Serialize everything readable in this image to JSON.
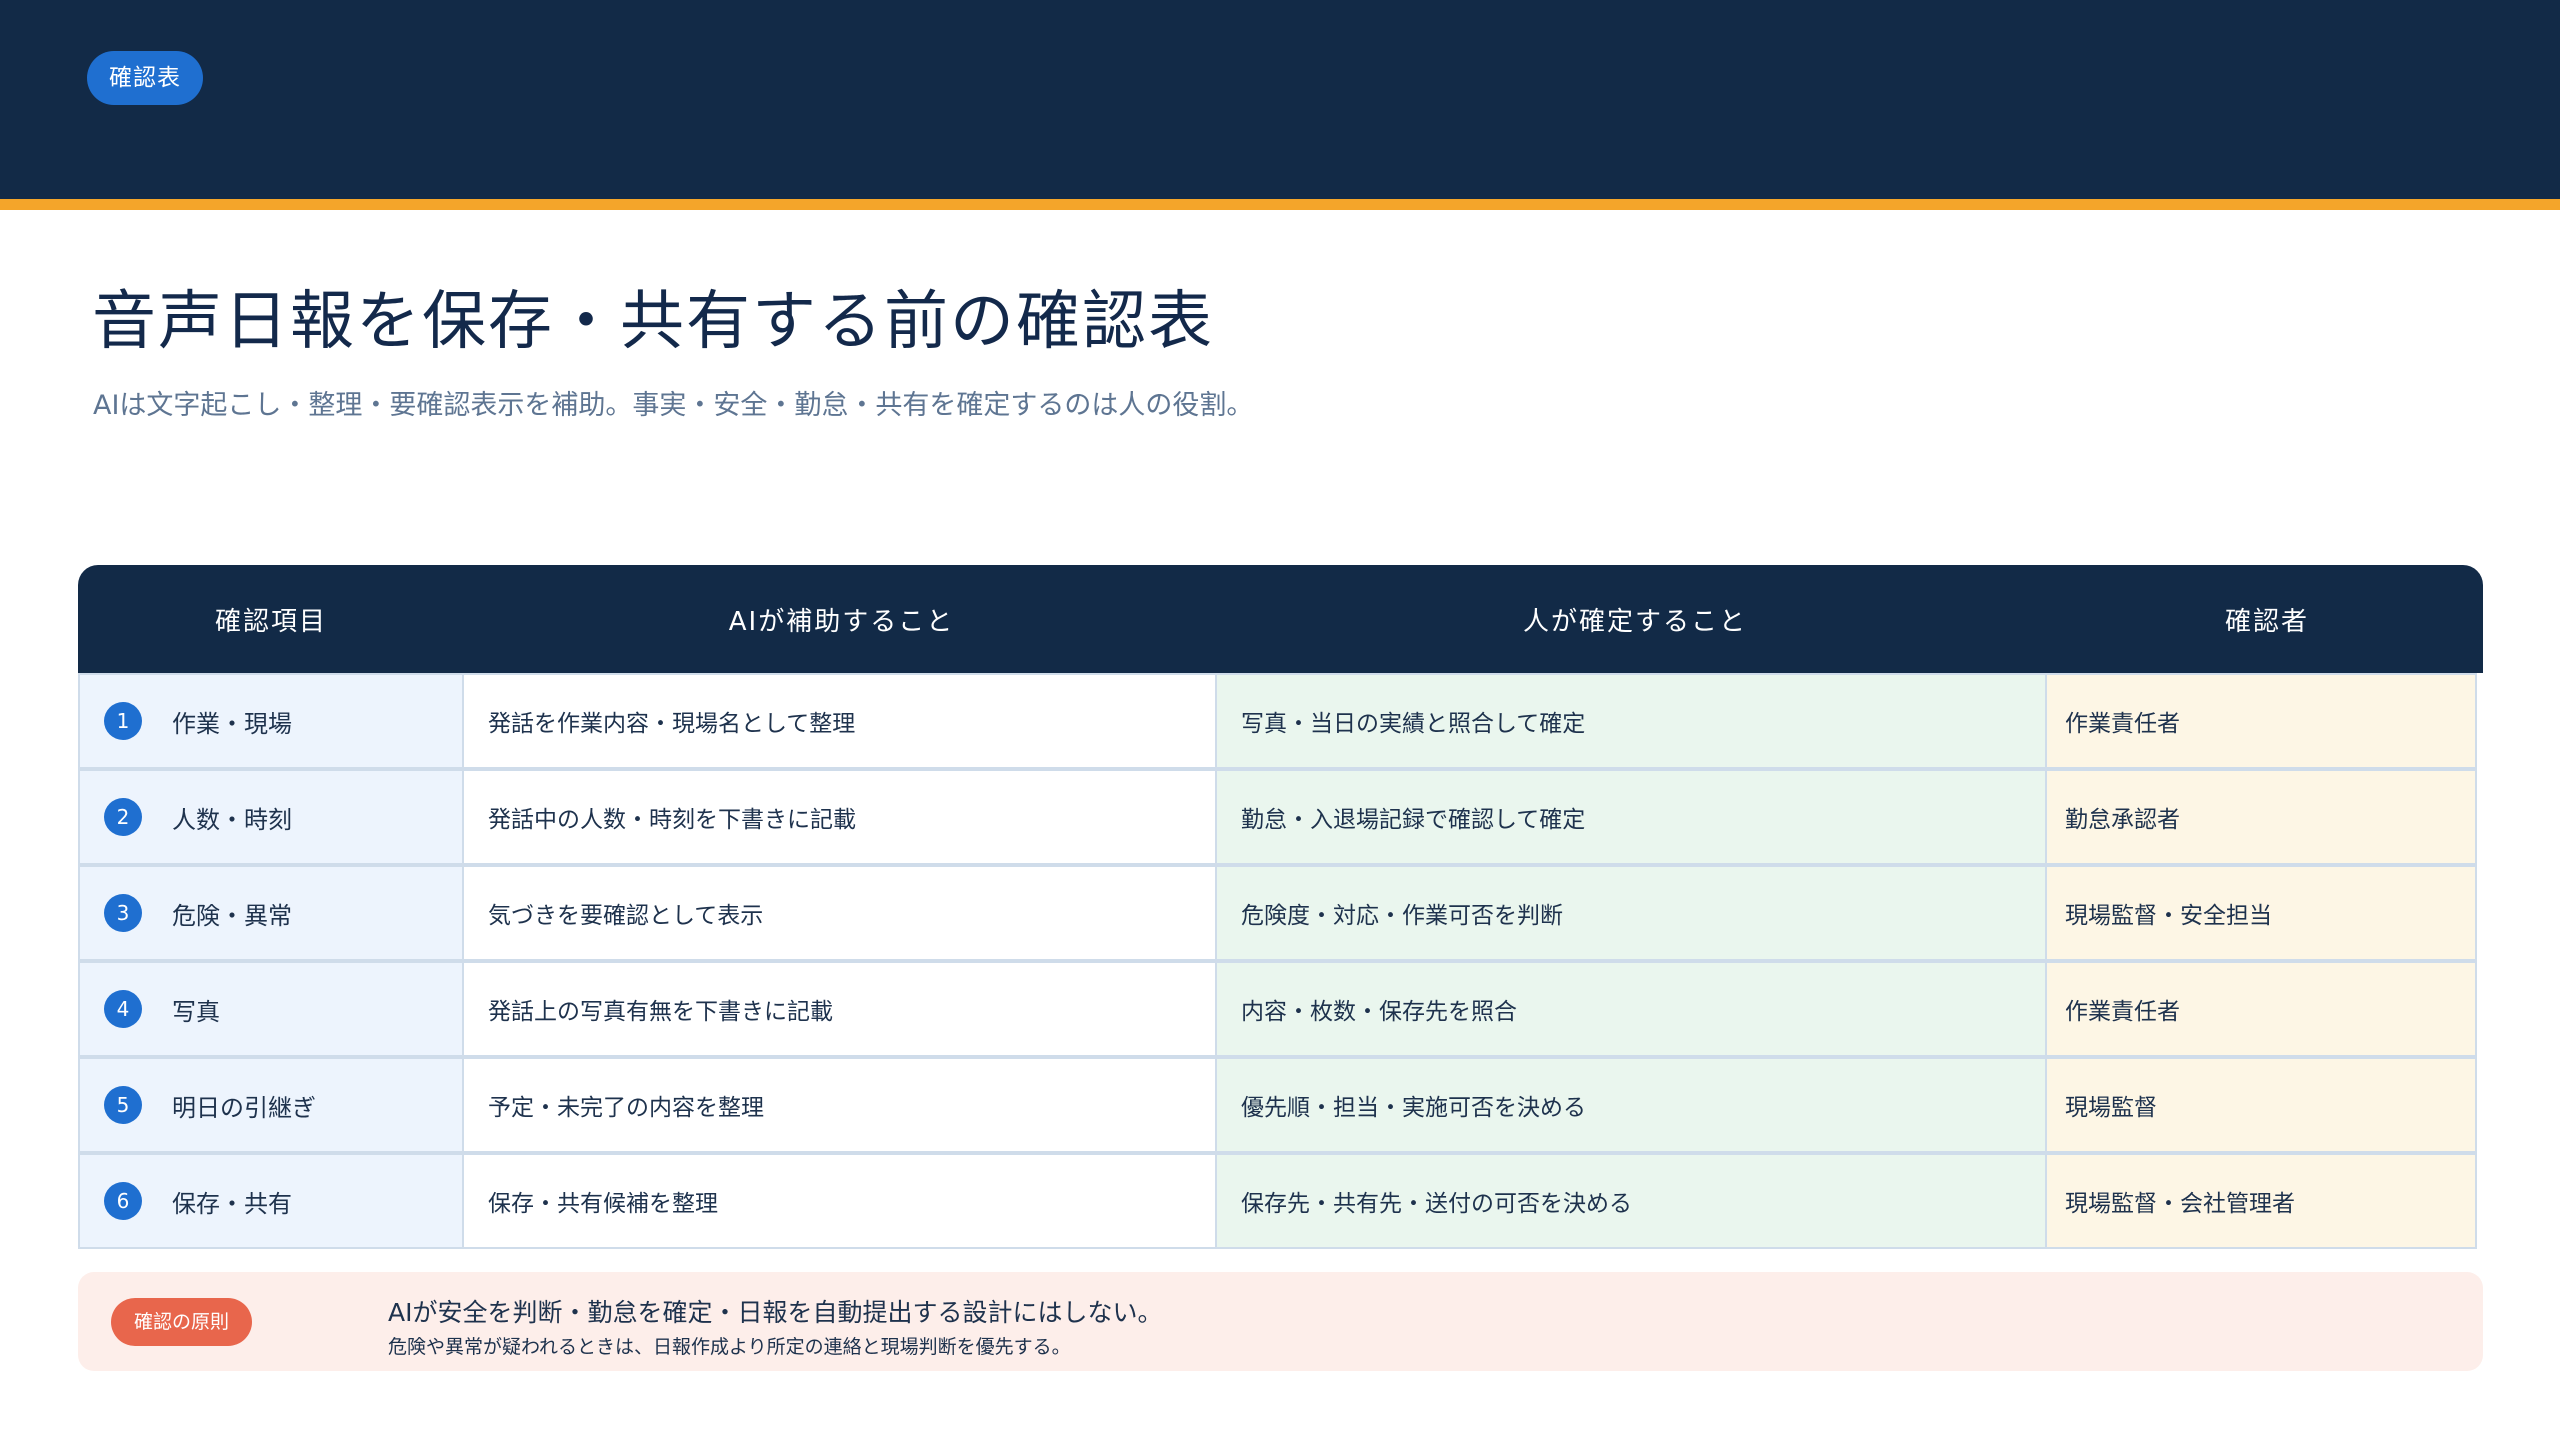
{
  "header": {
    "tag": "確認表",
    "bg_color": "#122a47",
    "stripe_color": "#f4a52a"
  },
  "page": {
    "title": "音声日報を保存・共有する前の確認表",
    "subtitle": "AIは文字起こし・整理・要確認表示を補助。事実・安全・勤怠・共有を確定するのは人の役割。"
  },
  "table": {
    "headers": [
      "確認項目",
      "AIが補助すること",
      "人が確定すること",
      "確認者"
    ],
    "rows": [
      {
        "num": "1",
        "item": "作業・現場",
        "ai": "発話を作業内容・現場名として整理",
        "human": "写真・当日の実績と照合して確定",
        "checker": "作業責任者"
      },
      {
        "num": "2",
        "item": "人数・時刻",
        "ai": "発話中の人数・時刻を下書きに記載",
        "human": "勤怠・入退場記録で確認して確定",
        "checker": "勤怠承認者"
      },
      {
        "num": "3",
        "item": "危険・異常",
        "ai": "気づきを要確認として表示",
        "human": "危険度・対応・作業可否を判断",
        "checker": "現場監督・安全担当"
      },
      {
        "num": "4",
        "item": "写真",
        "ai": "発話上の写真有無を下書きに記載",
        "human": "内容・枚数・保存先を照合",
        "checker": "作業責任者"
      },
      {
        "num": "5",
        "item": "明日の引継ぎ",
        "ai": "予定・未完了の内容を整理",
        "human": "優先順・担当・実施可否を決める",
        "checker": "現場監督"
      },
      {
        "num": "6",
        "item": "保存・共有",
        "ai": "保存・共有候補を整理",
        "human": "保存先・共有先・送付の可否を決める",
        "checker": "現場監督・会社管理者"
      }
    ]
  },
  "principle": {
    "tag": "確認の原則",
    "main": "AIが安全を判断・勤怠を確定・日報を自動提出する設計にはしない。",
    "sub": "危険や異常が疑われるときは、日報作成より所定の連絡と現場判断を優先する。"
  }
}
